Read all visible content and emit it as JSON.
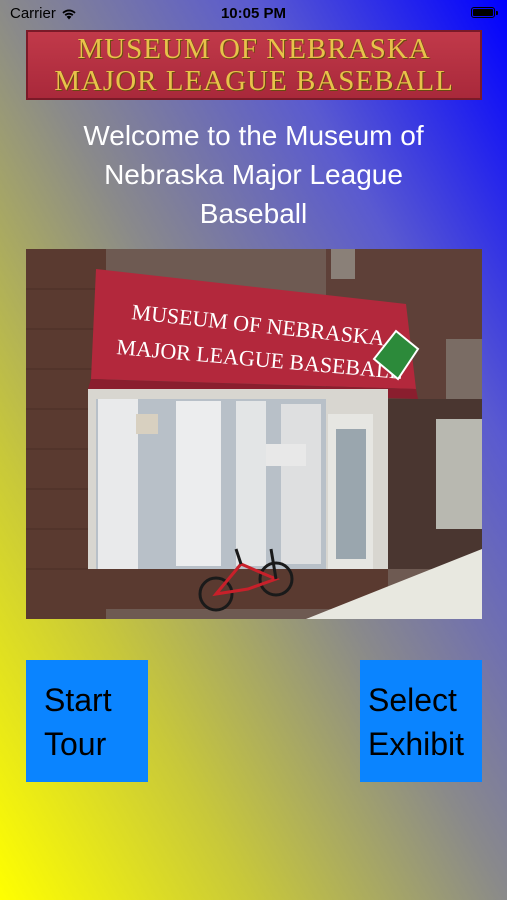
{
  "status_bar": {
    "carrier": "Carrier",
    "time": "10:05 PM"
  },
  "banner": {
    "line1": "MUSEUM OF NEBRASKA",
    "line2": "MAJOR LEAGUE BASEBALL"
  },
  "welcome": {
    "line1": "Welcome to the Museum of",
    "line2": "Nebraska Major League",
    "line3": "Baseball"
  },
  "photo": {
    "awning_line1": "MUSEUM OF NEBRASKA",
    "awning_line2": "MAJOR LEAGUE BASEBALL",
    "colors": {
      "awning": "#b3283c",
      "brick": "#5a3a30",
      "sidewalk": "#e8e8e0"
    }
  },
  "buttons": {
    "start_tour": {
      "line1": "Start",
      "line2": "Tour"
    },
    "select_exhibit": {
      "line1": "Select",
      "line2": "Exhibit"
    }
  },
  "colors": {
    "button_bg": "#0a84ff",
    "gradient_start": "#ffff00",
    "gradient_end": "#0000ff"
  }
}
